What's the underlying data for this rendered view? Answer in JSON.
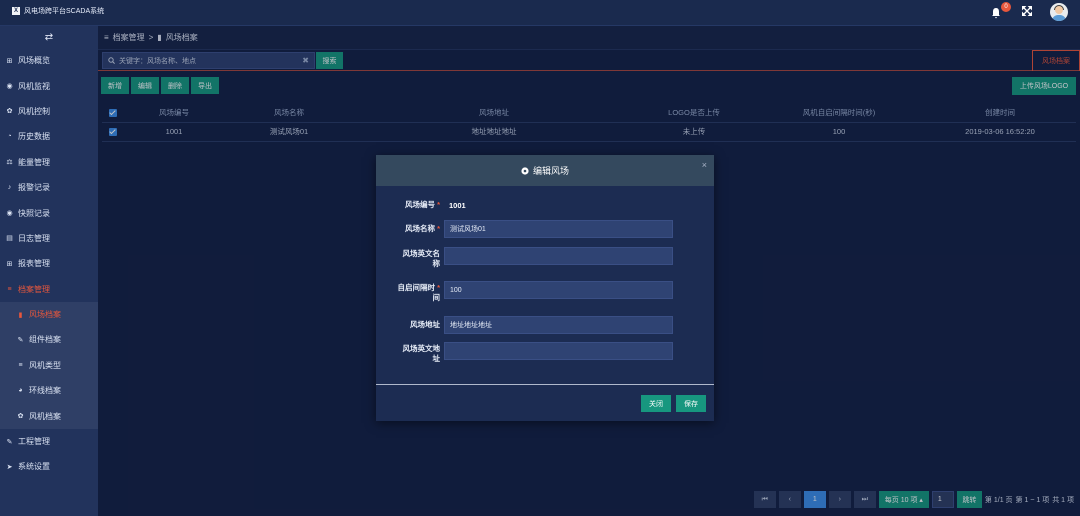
{
  "app": {
    "title": "风电场跨平台SCADA系统",
    "logo_glyph": "X",
    "notification_count": "0"
  },
  "sidebar": {
    "toggle_glyph": "⇄",
    "items": [
      {
        "label": "风场概览",
        "icon": "⊞"
      },
      {
        "label": "风机监视",
        "icon": "◉"
      },
      {
        "label": "风机控制",
        "icon": "✿"
      },
      {
        "label": "历史数据",
        "icon": "◔"
      },
      {
        "label": "能量管理",
        "icon": "⚖"
      },
      {
        "label": "报警记录",
        "icon": "♪"
      },
      {
        "label": "快照记录",
        "icon": "◉"
      },
      {
        "label": "日志管理",
        "icon": "▤"
      },
      {
        "label": "报表管理",
        "icon": "⊞"
      },
      {
        "label": "档案管理",
        "icon": "≡"
      }
    ],
    "sub_items": [
      {
        "label": "风场档案",
        "icon": "▮"
      },
      {
        "label": "组件档案",
        "icon": "✎"
      },
      {
        "label": "风机类型",
        "icon": "≡"
      },
      {
        "label": "环线档案",
        "icon": "◕"
      },
      {
        "label": "风机档案",
        "icon": "✿"
      }
    ],
    "bottom_items": [
      {
        "label": "工程管理",
        "icon": "✎"
      },
      {
        "label": "系统设置",
        "icon": "➤"
      }
    ]
  },
  "breadcrumb": {
    "root": "档案管理",
    "sep": ">",
    "current": "风场档案",
    "root_icon": "≡",
    "current_icon": "▮"
  },
  "search": {
    "placeholder": "关键字：风场名称、地点",
    "button": "搜索",
    "clear_glyph": "✖"
  },
  "tab": {
    "label": "风场档案"
  },
  "toolbar": {
    "add": "新增",
    "edit": "编辑",
    "delete": "删除",
    "export": "导出",
    "upload": "上传风场LOGO"
  },
  "table": {
    "headers": [
      "风场编号",
      "风场名称",
      "风场地址",
      "LOGO是否上传",
      "风机自启间隔时间(秒)",
      "创建时间"
    ],
    "rows": [
      [
        "1001",
        "测试风场01",
        "地址地址地址",
        "未上传",
        "100",
        "2019-03-06 16:52:20"
      ]
    ]
  },
  "modal": {
    "title": "编辑风场",
    "close_glyph": "×",
    "fields": {
      "code_label": "风场编号",
      "code_value": "1001",
      "name_label": "风场名称",
      "name_value": "测试风场01",
      "en_name_label_1": "风场英文名",
      "en_name_label_2": "称",
      "en_name_value": "",
      "interval_label_1": "自启间隔时",
      "interval_label_2": "间",
      "interval_value": "100",
      "address_label": "风场地址",
      "address_value": "地址地址地址",
      "en_address_label_1": "风场英文地",
      "en_address_label_2": "址",
      "en_address_value": "",
      "required_mark": "*"
    },
    "close_button": "关闭",
    "save_button": "保存"
  },
  "pagination": {
    "first": "⏮",
    "prev": "‹",
    "current_page": "1",
    "next": "›",
    "last": "⏭",
    "page_size": "每页 10 项 ▴",
    "jump_value": "1",
    "jump_button": "跳转",
    "page_info": "第 1/1 页",
    "range_info": "第 1 ~ 1 项",
    "total_info": "共 1 项"
  },
  "colors": {
    "accent": "#e8573c",
    "teal": "#17977f",
    "sidebar": "#22335c",
    "main": "#152246"
  }
}
